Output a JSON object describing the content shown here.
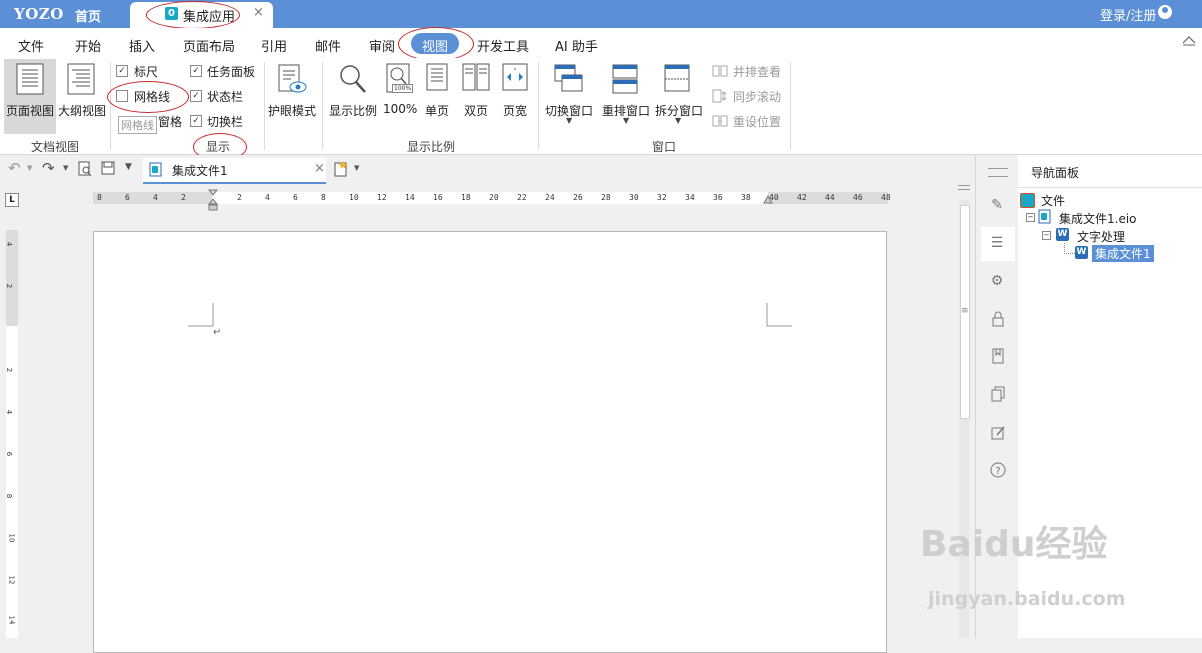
{
  "titlebar": {
    "logo": "YOZO",
    "home": "首页",
    "doc_tab": "集成应用",
    "doc_tab_icon": "0",
    "close": "×",
    "login": "登录/注册"
  },
  "menu": {
    "items": [
      "文件",
      "开始",
      "插入",
      "页面布局",
      "引用",
      "邮件",
      "审阅",
      "视图",
      "开发工具",
      "AI 助手"
    ],
    "active": "视图"
  },
  "ribbon": {
    "doc_view": {
      "page_view": "页面视图",
      "outline_view": "大纲视图",
      "group": "文档视图"
    },
    "display": {
      "ruler": "标尺",
      "gridlines": "网格线",
      "tooltip": "网格线",
      "window_pane": "窗格",
      "task_pane": "任务面板",
      "status_bar": "状态栏",
      "switch_bar": "切换栏",
      "group": "显示"
    },
    "eye_mode": "护眼模式",
    "zoom": {
      "zoom": "显示比例",
      "hundred": "100%",
      "single": "单页",
      "double": "双页",
      "page_width": "页宽",
      "group": "显示比例",
      "hundred_badge": "100%"
    },
    "window": {
      "switch": "切换窗口",
      "arrange": "重排窗口",
      "split": "拆分窗口",
      "side_by_side": "并排查看",
      "sync_scroll": "同步滚动",
      "reset_pos": "重设位置",
      "group": "窗口"
    }
  },
  "file_tab": {
    "label": "集成文件1",
    "close": "×"
  },
  "ruler": {
    "ticks": [
      "8",
      "6",
      "4",
      "2",
      "2",
      "4",
      "6",
      "8",
      "10",
      "12",
      "14",
      "16",
      "18",
      "20",
      "22",
      "24",
      "26",
      "28",
      "30",
      "32",
      "34",
      "36",
      "38",
      "40",
      "42",
      "44",
      "46",
      "48"
    ],
    "corner": "L",
    "vticks": [
      "4",
      "2",
      "2",
      "4",
      "6",
      "8",
      "10",
      "12",
      "14"
    ]
  },
  "nav": {
    "title": "导航面板",
    "root": "文件",
    "eio": "集成文件1.eio",
    "wp": "文字处理",
    "doc": "集成文件1"
  },
  "watermark": {
    "brand": "Baidu经验",
    "url": "jingyan.baidu.com"
  },
  "colors": {
    "accent": "#5b8fd6",
    "annotation": "#c62828"
  }
}
